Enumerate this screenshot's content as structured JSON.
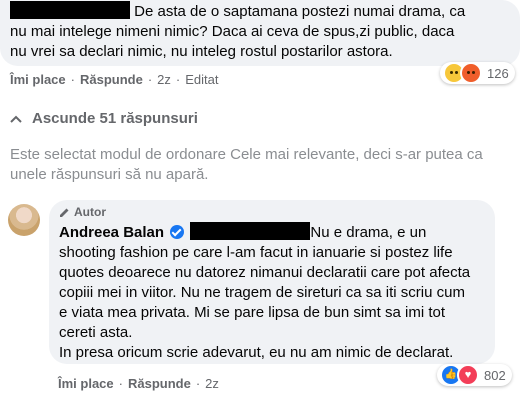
{
  "comment1": {
    "line1": "De asta de o saptamana postezi numai drama, ca",
    "line2": "nu mai intelege nimeni nimic? Daca ai ceva de spus,zi public, daca",
    "line3": "nu vrei sa declari nimic, nu inteleg rostul postarilor astora.",
    "actions": {
      "like": "Îmi place",
      "reply": "Răspunde",
      "time": "2z",
      "edited": "Editat"
    },
    "reactions": {
      "icons": [
        "sad-icon",
        "angry-icon"
      ],
      "count": "126"
    }
  },
  "thread": {
    "hide_label": "Ascunde 51 răspunsuri",
    "notice_line1": "Este selectat modul de ordonare Cele mai relevante, deci s-ar putea ca",
    "notice_line2": "unele răspunsuri să nu apară."
  },
  "comment2": {
    "author_tag": "Autor",
    "author_name": "Andreea Balan",
    "line1_after": "Nu e drama, e un",
    "line2": "shooting fashion pe care l-am facut in ianuarie si postez life",
    "line3": "quotes deoarece nu datorez nimanui declaratii care pot afecta",
    "line4": "copiii mei in viitor. Nu ne tragem de sireturi ca sa iti scriu cum",
    "line5": "e viata mea privata. Mi se pare lipsa de bun simt sa imi tot",
    "line6": "cereti asta.",
    "line7": "In presa oricum scrie adevarut, eu nu am nimic de declarat.",
    "actions": {
      "like": "Îmi place",
      "reply": "Răspunde",
      "time": "2z"
    },
    "reactions": {
      "icons": [
        "like-icon",
        "love-icon"
      ],
      "count": "802"
    }
  },
  "colors": {
    "bubble": "#f0f2f5",
    "secondary_text": "#65676b",
    "link_blue": "#1877f2"
  }
}
